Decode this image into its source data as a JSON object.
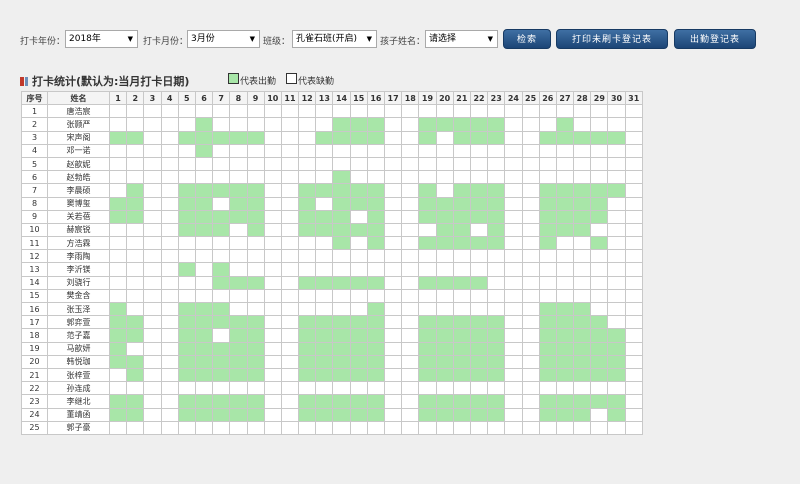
{
  "toolbar": {
    "year_label": "打卡年份：",
    "year_value": "2018年",
    "month_label": "打卡月份：",
    "month_value": "3月份",
    "class_label": "班级：",
    "class_value": "孔雀石班(开启)",
    "child_label": "孩子姓名：",
    "child_value": "请选择",
    "search_button": "检索",
    "print_unpunched_button": "打印未刷卡登记表",
    "attendance_register_button": "出勤登记表"
  },
  "section": {
    "title": "打卡统计(默认为:当月打卡日期)",
    "legend_present": "代表出勤",
    "legend_absent": "代表缺勤",
    "present_color": "#a8e6a8",
    "absent_color": "#ffffff"
  },
  "table": {
    "col_index": "序号",
    "col_name": "姓名",
    "days": [
      "1",
      "2",
      "3",
      "4",
      "5",
      "6",
      "7",
      "8",
      "9",
      "10",
      "11",
      "12",
      "13",
      "14",
      "15",
      "16",
      "17",
      "18",
      "19",
      "20",
      "21",
      "22",
      "23",
      "24",
      "25",
      "26",
      "27",
      "28",
      "29",
      "30",
      "31"
    ],
    "rows": [
      {
        "no": "1",
        "name": "唐浩宸",
        "present": []
      },
      {
        "no": "2",
        "name": "张颢严",
        "present": [
          6,
          14,
          15,
          16,
          19,
          20,
          21,
          22,
          23,
          27
        ]
      },
      {
        "no": "3",
        "name": "宋声阁",
        "present": [
          1,
          2,
          5,
          6,
          7,
          8,
          9,
          13,
          14,
          15,
          16,
          19,
          21,
          22,
          23,
          26,
          27,
          28,
          29,
          30
        ]
      },
      {
        "no": "4",
        "name": "邓一诺",
        "present": [
          6
        ]
      },
      {
        "no": "5",
        "name": "赵歆妮",
        "present": []
      },
      {
        "no": "6",
        "name": "赵勃皓",
        "present": [
          14
        ]
      },
      {
        "no": "7",
        "name": "李晨硕",
        "present": [
          2,
          5,
          6,
          7,
          8,
          9,
          12,
          13,
          14,
          15,
          16,
          19,
          21,
          22,
          23,
          26,
          27,
          28,
          29,
          30
        ]
      },
      {
        "no": "8",
        "name": "窦博玺",
        "present": [
          1,
          2,
          5,
          6,
          8,
          9,
          12,
          14,
          15,
          16,
          19,
          20,
          21,
          22,
          23,
          26,
          27,
          28,
          29
        ]
      },
      {
        "no": "9",
        "name": "关若蓓",
        "present": [
          1,
          2,
          5,
          6,
          7,
          8,
          9,
          12,
          13,
          14,
          16,
          19,
          20,
          21,
          22,
          23,
          26,
          27,
          28,
          29
        ]
      },
      {
        "no": "10",
        "name": "赫宸锐",
        "present": [
          5,
          6,
          7,
          9,
          12,
          13,
          14,
          15,
          16,
          20,
          21,
          23,
          26,
          27,
          28
        ]
      },
      {
        "no": "11",
        "name": "方浩霖",
        "present": [
          14,
          16,
          19,
          20,
          21,
          22,
          23,
          26,
          29
        ]
      },
      {
        "no": "12",
        "name": "李雨陶",
        "present": []
      },
      {
        "no": "13",
        "name": "李沂镁",
        "present": [
          5,
          7
        ]
      },
      {
        "no": "14",
        "name": "刘骁行",
        "present": [
          7,
          8,
          9,
          12,
          13,
          14,
          15,
          16,
          19,
          20,
          21,
          22
        ]
      },
      {
        "no": "15",
        "name": "樊金含",
        "present": []
      },
      {
        "no": "16",
        "name": "张玉泽",
        "present": [
          1,
          5,
          6,
          7,
          16,
          26,
          27,
          28
        ]
      },
      {
        "no": "17",
        "name": "郭弈萱",
        "present": [
          1,
          2,
          5,
          6,
          7,
          8,
          9,
          12,
          13,
          14,
          15,
          16,
          19,
          20,
          21,
          22,
          23,
          26,
          27,
          28,
          29
        ]
      },
      {
        "no": "18",
        "name": "范子嘉",
        "present": [
          1,
          2,
          5,
          6,
          8,
          9,
          12,
          13,
          14,
          15,
          16,
          19,
          20,
          21,
          22,
          23,
          26,
          27,
          28,
          29,
          30
        ]
      },
      {
        "no": "19",
        "name": "马歆妍",
        "present": [
          1,
          5,
          6,
          7,
          8,
          9,
          12,
          13,
          14,
          15,
          16,
          19,
          20,
          21,
          22,
          23,
          26,
          27,
          28,
          29,
          30
        ]
      },
      {
        "no": "20",
        "name": "韩悦珈",
        "present": [
          1,
          2,
          5,
          6,
          7,
          8,
          9,
          12,
          13,
          14,
          15,
          16,
          19,
          20,
          21,
          22,
          23,
          26,
          27,
          28,
          29,
          30
        ]
      },
      {
        "no": "21",
        "name": "张梓萱",
        "present": [
          2,
          5,
          6,
          7,
          8,
          9,
          12,
          13,
          14,
          15,
          16,
          19,
          20,
          21,
          22,
          23,
          26,
          27,
          28,
          29,
          30
        ]
      },
      {
        "no": "22",
        "name": "孙连成",
        "present": []
      },
      {
        "no": "23",
        "name": "李继北",
        "present": [
          1,
          2,
          5,
          6,
          7,
          8,
          9,
          12,
          13,
          14,
          15,
          16,
          19,
          20,
          21,
          22,
          23,
          26,
          27,
          28,
          29,
          30
        ]
      },
      {
        "no": "24",
        "name": "董靖函",
        "present": [
          1,
          2,
          5,
          6,
          7,
          8,
          9,
          12,
          13,
          14,
          15,
          16,
          19,
          20,
          21,
          22,
          23,
          26,
          27,
          28,
          30
        ]
      },
      {
        "no": "25",
        "name": "郭子豪",
        "present": []
      }
    ]
  }
}
